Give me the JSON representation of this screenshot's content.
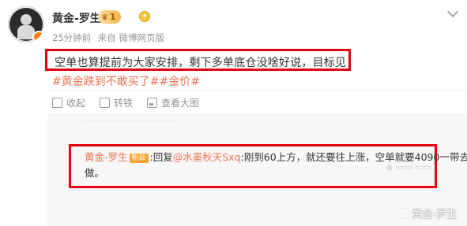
{
  "author": {
    "name": "黄金-罗生",
    "vip_level": "1"
  },
  "meta": {
    "time": "25分钟前",
    "source": "来自 微博网页版"
  },
  "post": {
    "text": "空单也算提前为大家安排，剩下多单底仓没啥好说，目标见",
    "tags": "#黄金跌到不敢买了##金价#"
  },
  "actions": {
    "collect": "收起",
    "share": "转铁",
    "view_image": "查看大图"
  },
  "comment": {
    "author": "黄金-罗生",
    "fan_badge": "粉丝",
    "reply_prefix": ":回复",
    "mention": "@水墨秋天Sxq",
    "line1_rest": ":刚到60上方，就还要往上涨，空单就要4090一带去",
    "line2": "做。"
  },
  "watermark": "黄金-罗生",
  "colors": {
    "highlight_border": "#e60012",
    "link_orange": "#eb7350",
    "meta_gray": "#939393"
  }
}
